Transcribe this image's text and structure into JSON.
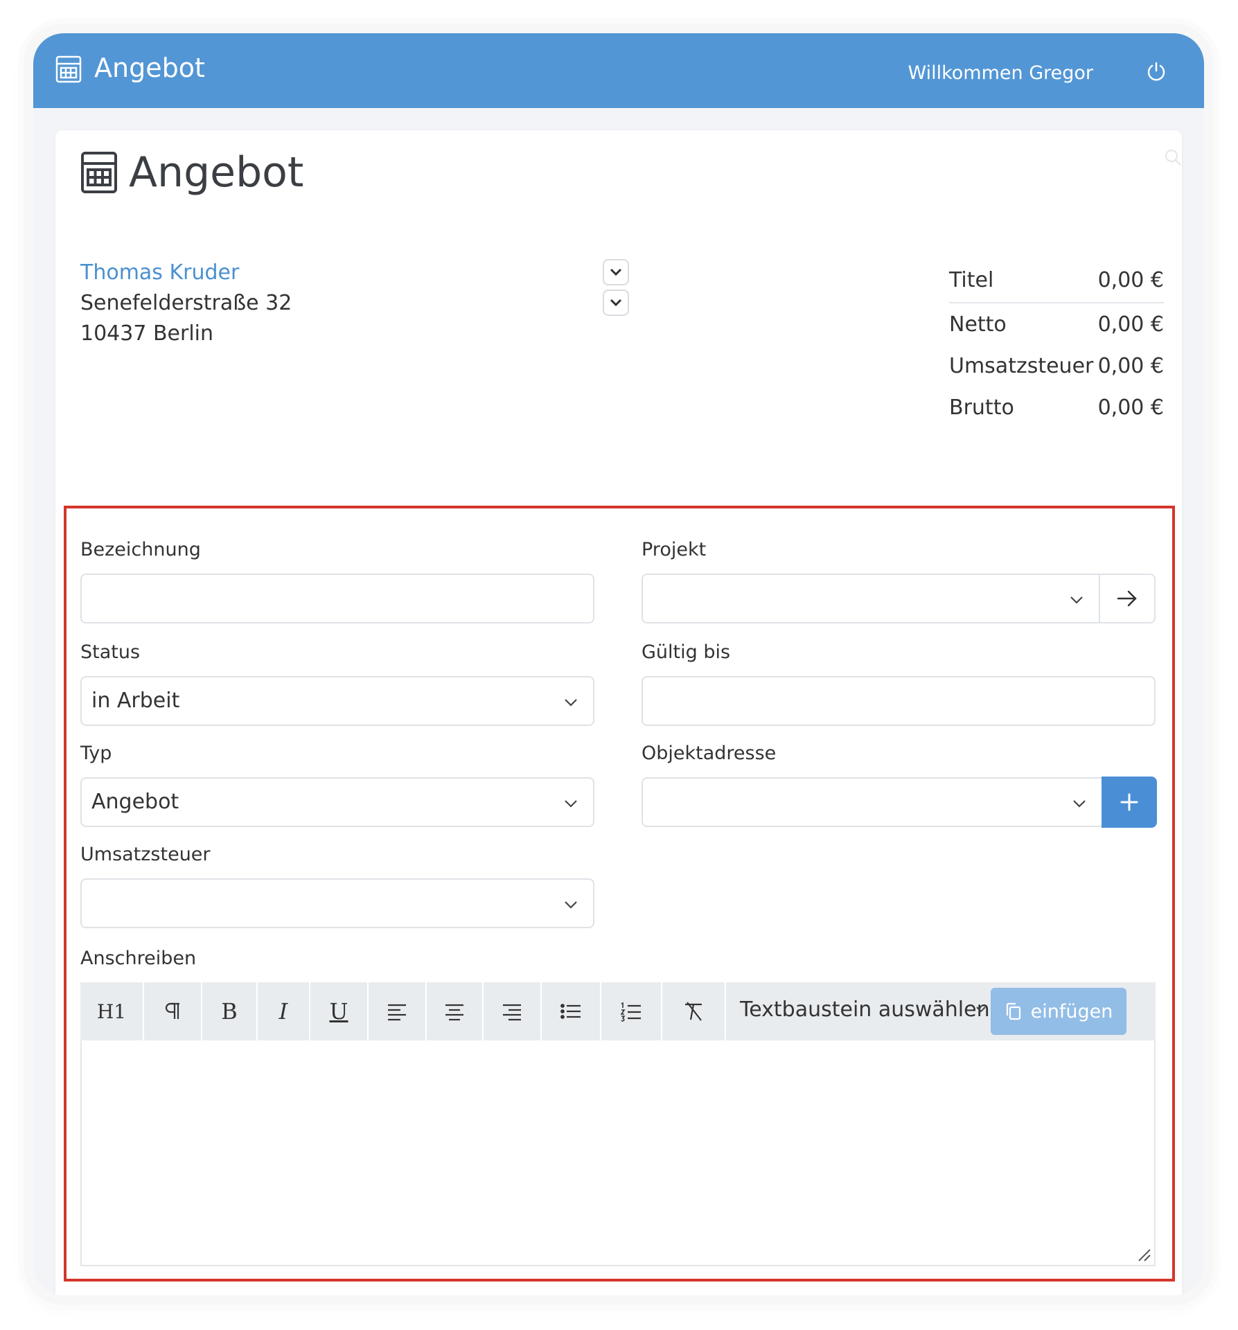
{
  "topbar": {
    "title": "Angebot",
    "welcome": "Willkommen Gregor",
    "color": "#5296d5"
  },
  "page": {
    "title": "Angebot"
  },
  "customer": {
    "name": "Thomas Kruder",
    "street": "Senefelderstraße 32",
    "city": "10437 Berlin"
  },
  "totals": [
    {
      "label": "Titel",
      "value": "0,00 €"
    },
    {
      "label": "Netto",
      "value": "0,00 €"
    },
    {
      "label": "Umsatzsteuer",
      "value": "0,00 €"
    },
    {
      "label": "Brutto",
      "value": "0,00 €"
    }
  ],
  "form": {
    "bezeichnung": {
      "label": "Bezeichnung",
      "value": ""
    },
    "projekt": {
      "label": "Projekt",
      "value": ""
    },
    "status": {
      "label": "Status",
      "value": "in Arbeit"
    },
    "gueltig_bis": {
      "label": "Gültig bis",
      "value": ""
    },
    "typ": {
      "label": "Typ",
      "value": "Angebot"
    },
    "objektadresse": {
      "label": "Objektadresse",
      "value": ""
    },
    "umsatzsteuer": {
      "label": "Umsatzsteuer",
      "value": ""
    },
    "anschreiben": {
      "label": "Anschreiben"
    }
  },
  "editor": {
    "h1_label": "H1",
    "bold_label": "B",
    "italic_label": "I",
    "underline_label": "U",
    "textbaustein_placeholder": "Textbaustein auswählen",
    "insert_label": "einfügen"
  },
  "colors": {
    "accent": "#4a8fd6",
    "link": "#4a90d0",
    "highlight_border": "#d4352a",
    "insert_button": "#92bde6"
  }
}
